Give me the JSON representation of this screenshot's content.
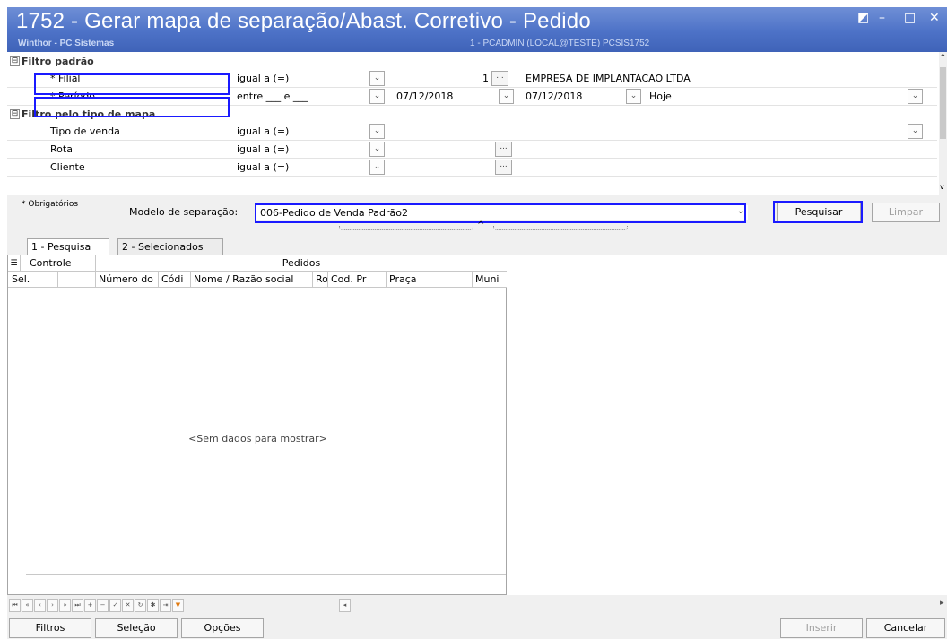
{
  "window": {
    "title": "1752 - Gerar mapa de separação/Abast. Corretivo - Pedido",
    "subtitle": "Winthor - PC Sistemas",
    "user_info": "1 - PCADMIN (LOCAL@TESTE)   PCSIS1752",
    "buttons": {
      "restore": "◩",
      "minimize": "–",
      "maximize": "□",
      "close": "✕"
    }
  },
  "filters": {
    "group_default": {
      "title": "Filtro padrão",
      "expander": "⊟"
    },
    "filial": {
      "name": "* Filial",
      "condition": "igual a (=)",
      "value": "1",
      "ellipsis": "...",
      "description": "EMPRESA DE IMPLANTACAO LTDA"
    },
    "periodo": {
      "name": "* Período",
      "condition": "entre ___ e ___",
      "from": "07/12/2018",
      "to": "07/12/2018",
      "preset": "Hoje"
    },
    "group_map": {
      "title": "Filtro pelo tipo de mapa",
      "expander": "⊟"
    },
    "tipo_venda": {
      "name": "Tipo de venda",
      "condition": "igual a (=)"
    },
    "rota": {
      "name": "Rota",
      "condition": "igual a (=)",
      "ellipsis": "..."
    },
    "cliente": {
      "name": "Cliente",
      "condition": "igual a (=)",
      "ellipsis": "..."
    }
  },
  "search": {
    "required_note": "* Obrigatórios",
    "model_label": "Modelo de separação:",
    "model_value": "006-Pedido de Venda Padrão2",
    "search_button": "Pesquisar",
    "clear_button": "Limpar"
  },
  "tabs": [
    {
      "label": "1 - Pesquisa"
    },
    {
      "label": "2 - Selecionados"
    }
  ],
  "grid": {
    "group_headers": {
      "controle": "Controle",
      "pedidos": "Pedidos"
    },
    "columns": [
      "Sel.",
      "Número do",
      "Códi",
      "Nome / Razão social",
      "Ro",
      "Cod. Pr",
      "Praça",
      "Muni"
    ],
    "empty_text": "<Sem dados para mostrar>"
  },
  "navigator": {
    "buttons": [
      "⏮",
      "«",
      "‹",
      "›",
      "»",
      "⏭",
      "+",
      "−",
      "✓",
      "✕",
      "↻",
      "✱",
      "⇥",
      "▼"
    ],
    "scroll_left": "◂",
    "scroll_right": "▸"
  },
  "bottom": {
    "filtros": "Filtros",
    "selecao": "Seleção",
    "opcoes": "Opções",
    "inserir": "Inserir",
    "cancelar": "Cancelar"
  },
  "colors": {
    "title_bar": "#4d72c7",
    "highlight": "#1a1aff",
    "panel": "#f0f0f0"
  }
}
